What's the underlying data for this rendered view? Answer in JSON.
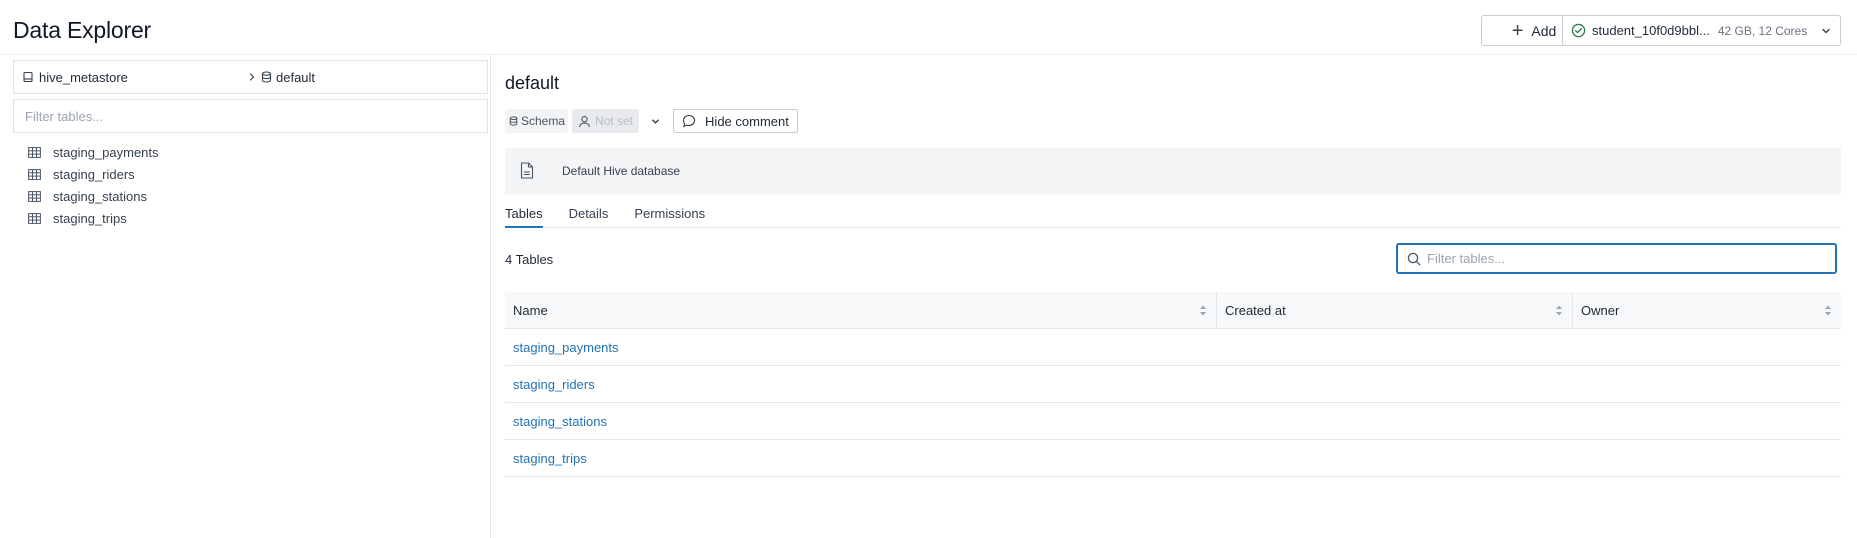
{
  "header": {
    "title": "Data Explorer",
    "add_label": "Add",
    "cluster_name": "student_10f0d9bbl...",
    "cluster_meta": "42 GB, 12 Cores"
  },
  "sidebar": {
    "catalog": "hive_metastore",
    "schema": "default",
    "filter_placeholder": "Filter tables...",
    "tables": [
      "staging_payments",
      "staging_riders",
      "staging_stations",
      "staging_trips"
    ]
  },
  "main": {
    "schema_title": "default",
    "schema_chip": "Schema",
    "owner_chip": "Not set",
    "hide_comment_label": "Hide comment",
    "comment": "Default Hive database",
    "tabs": [
      "Tables",
      "Details",
      "Permissions"
    ],
    "table_count": "4 Tables",
    "filter_placeholder": "Filter tables...",
    "columns": [
      "Name",
      "Created at",
      "Owner"
    ],
    "rows": [
      {
        "name": "staging_payments",
        "created_at": "",
        "owner": ""
      },
      {
        "name": "staging_riders",
        "created_at": "",
        "owner": ""
      },
      {
        "name": "staging_stations",
        "created_at": "",
        "owner": ""
      },
      {
        "name": "staging_trips",
        "created_at": "",
        "owner": ""
      }
    ]
  },
  "colors": {
    "accent": "#2272b4",
    "success": "#277c43",
    "border": "#dfe2e6"
  },
  "icons": {
    "add": "plus-icon",
    "cluster_status": "check-circle-icon",
    "dropdown": "chevron-down-icon",
    "catalog": "catalog-icon",
    "breadcrumb_sep": "chevron-right-icon",
    "schema": "database-icon",
    "table": "table-icon",
    "owner": "user-icon",
    "comment": "speech-bubble-icon",
    "document": "document-icon",
    "search": "search-icon",
    "sort": "sort-icon"
  }
}
